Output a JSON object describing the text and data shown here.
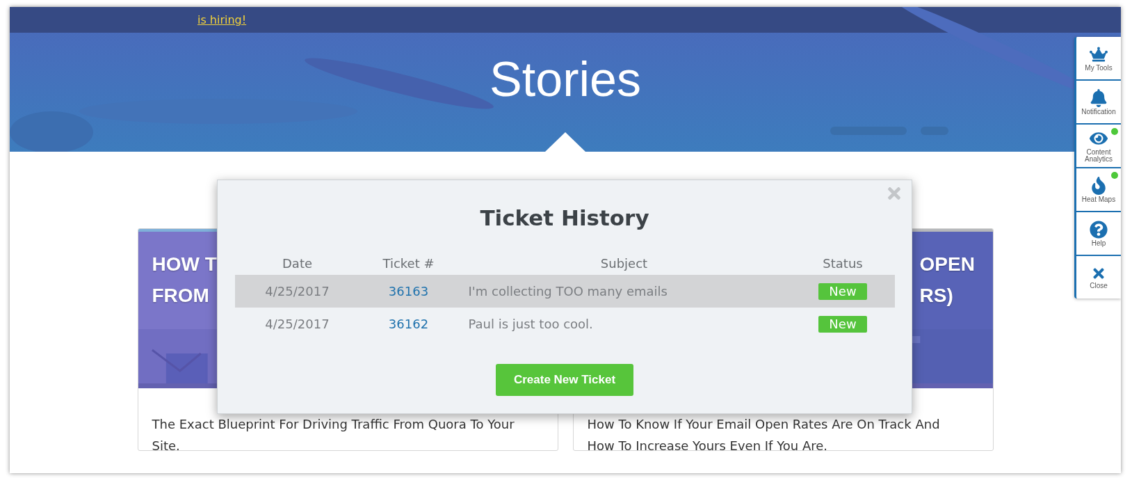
{
  "banner": {
    "link": "is hiring!"
  },
  "hero": {
    "title": "Stories"
  },
  "cards": [
    {
      "title_lines": [
        "HOW T",
        "FROM"
      ],
      "description": "The Exact Blueprint For Driving Traffic From Quora To Your Site."
    },
    {
      "title_lines": [
        "OPEN",
        "RS)"
      ],
      "description": "How To Know If Your Email Open Rates Are On Track And How To Increase Yours Even If You Are."
    }
  ],
  "modal": {
    "title": "Ticket History",
    "columns": [
      "Date",
      "Ticket #",
      "Subject",
      "Status"
    ],
    "rows": [
      {
        "date": "4/25/2017",
        "ticket": "36163",
        "subject": "I'm collecting TOO many emails",
        "status": "New",
        "selected": true
      },
      {
        "date": "4/25/2017",
        "ticket": "36162",
        "subject": "Paul is just too cool.",
        "status": "New",
        "selected": false
      }
    ],
    "button": "Create New Ticket"
  },
  "sidebar": {
    "items": [
      {
        "label": "My Tools",
        "indicator": false
      },
      {
        "label": "Notification",
        "indicator": false
      },
      {
        "label": "Content Analytics",
        "indicator": true
      },
      {
        "label": "Heat Maps",
        "indicator": true
      },
      {
        "label": "Help",
        "indicator": false
      },
      {
        "label": "Close",
        "indicator": false
      }
    ]
  }
}
